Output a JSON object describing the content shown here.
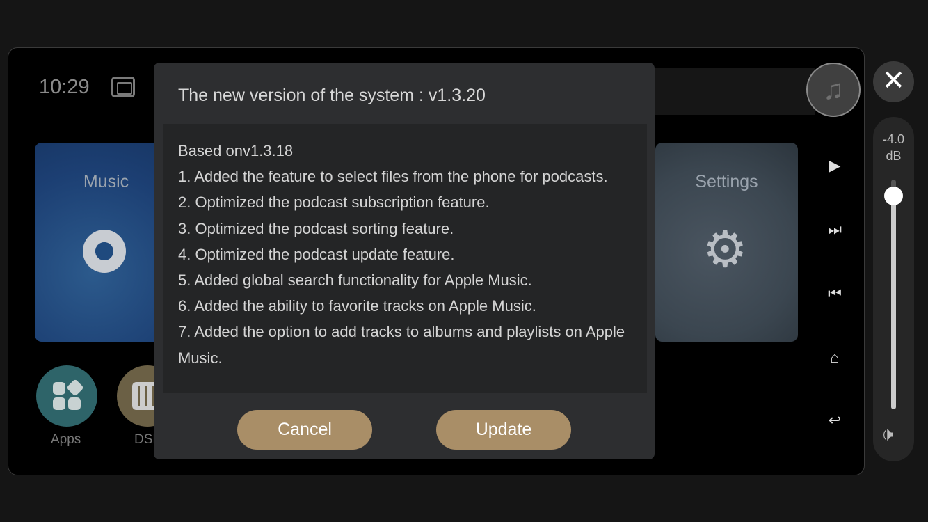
{
  "status": {
    "time": "10:29",
    "usb_icon": "usb-icon"
  },
  "tiles": {
    "music": "Music",
    "settings": "Settings"
  },
  "bottom": {
    "apps": "Apps",
    "dsp": "DSP"
  },
  "controls": [
    "play-icon",
    "next-icon",
    "previous-icon",
    "home-icon",
    "back-icon"
  ],
  "volume": {
    "value": "-4.0",
    "unit": "dB",
    "level": 0.93
  },
  "dialog": {
    "title": "The new version of the system :  v1.3.20",
    "lines": [
      "Based onv1.3.18",
      "1. Added the feature to select files from the phone for podcasts.",
      "2. Optimized the podcast subscription feature.",
      "3. Optimized the podcast sorting feature.",
      "4. Optimized the podcast update feature.",
      "5. Added global search functionality for Apple Music.",
      "6. Added the ability to favorite tracks on Apple Music.",
      "7. Added the option to add tracks to albums and playlists on Apple Music."
    ],
    "cancel": "Cancel",
    "update": "Update"
  },
  "colors": {
    "accent": "#a98e67"
  }
}
